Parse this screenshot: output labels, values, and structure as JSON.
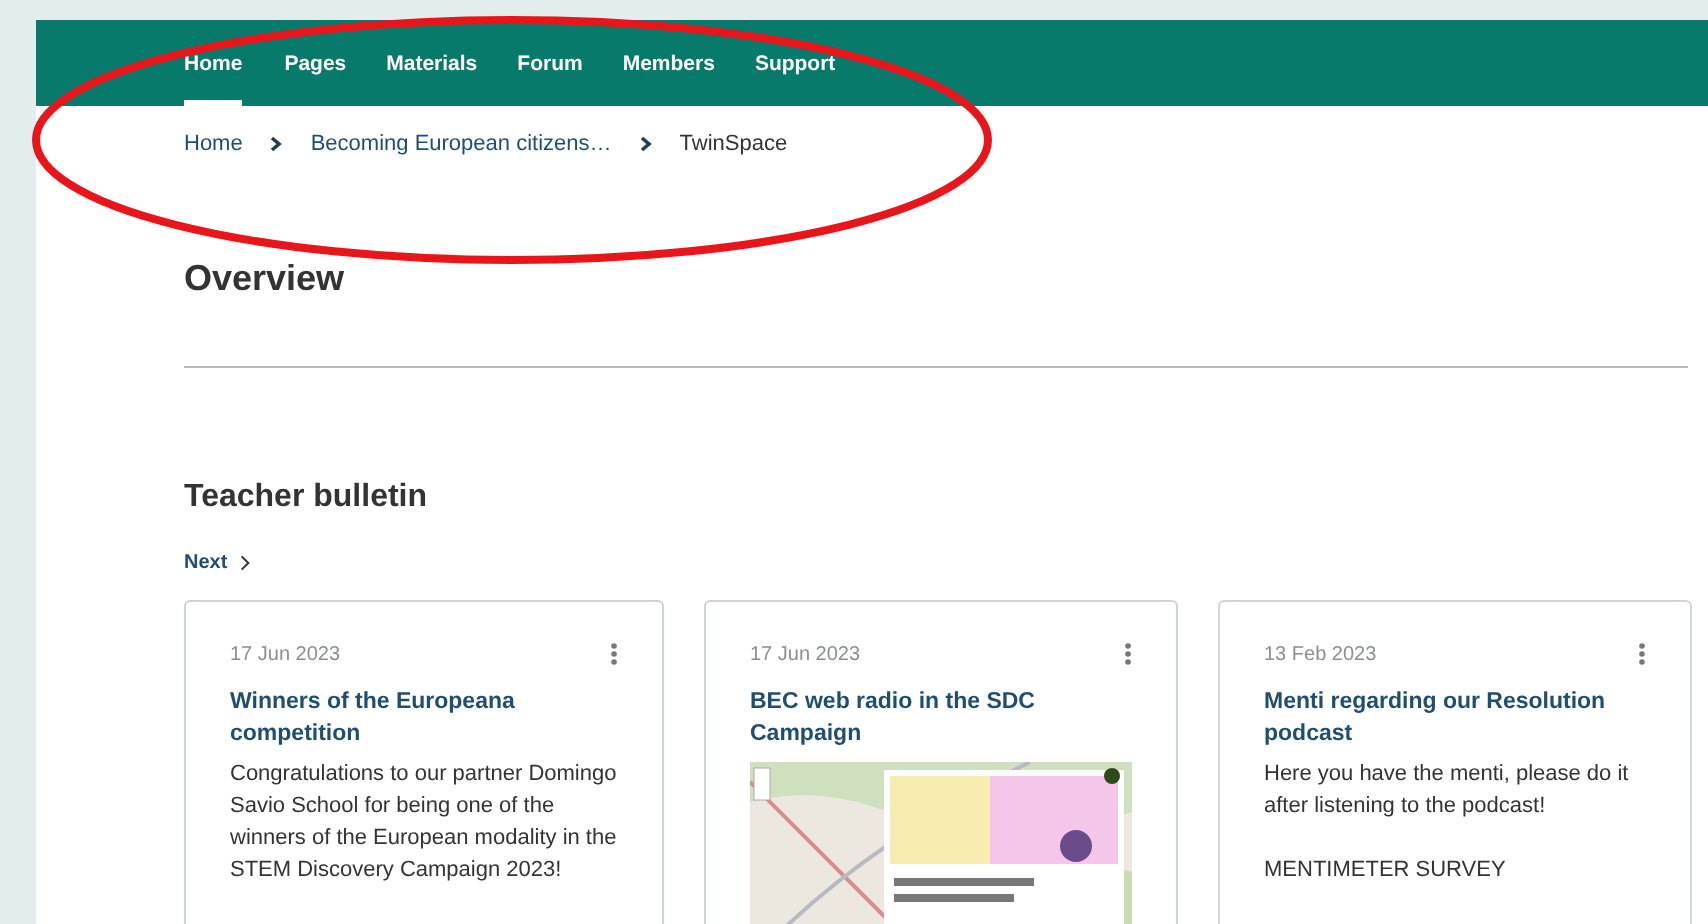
{
  "nav": {
    "items": [
      {
        "label": "Home",
        "selected": true
      },
      {
        "label": "Pages",
        "selected": false
      },
      {
        "label": "Materials",
        "selected": false
      },
      {
        "label": "Forum",
        "selected": false
      },
      {
        "label": "Members",
        "selected": false
      },
      {
        "label": "Support",
        "selected": false
      }
    ]
  },
  "breadcrumbs": [
    "Home",
    "Becoming European citizens…",
    "TwinSpace"
  ],
  "title": "Overview",
  "bulletin": {
    "heading": "Teacher bulletin",
    "next": "Next",
    "cards": [
      {
        "date": "17 Jun 2023",
        "title": "Winners of the Europeana competition",
        "body": [
          "Congratulations to our partner Domingo Savio School for being one of the winners of the European modality in the STEM Discovery Campaign 2023!"
        ]
      },
      {
        "date": "17 Jun 2023",
        "title": "BEC web radio in the SDC Campaign"
      },
      {
        "date": "13 Feb 2023",
        "title": "Menti regarding our Resolution podcast",
        "body": [
          "Here you have the menti, please do it after listening to the podcast!",
          "MENTIMETER SURVEY"
        ]
      }
    ]
  },
  "annotation": {
    "kind": "ellipse",
    "color": "#e8161b"
  }
}
